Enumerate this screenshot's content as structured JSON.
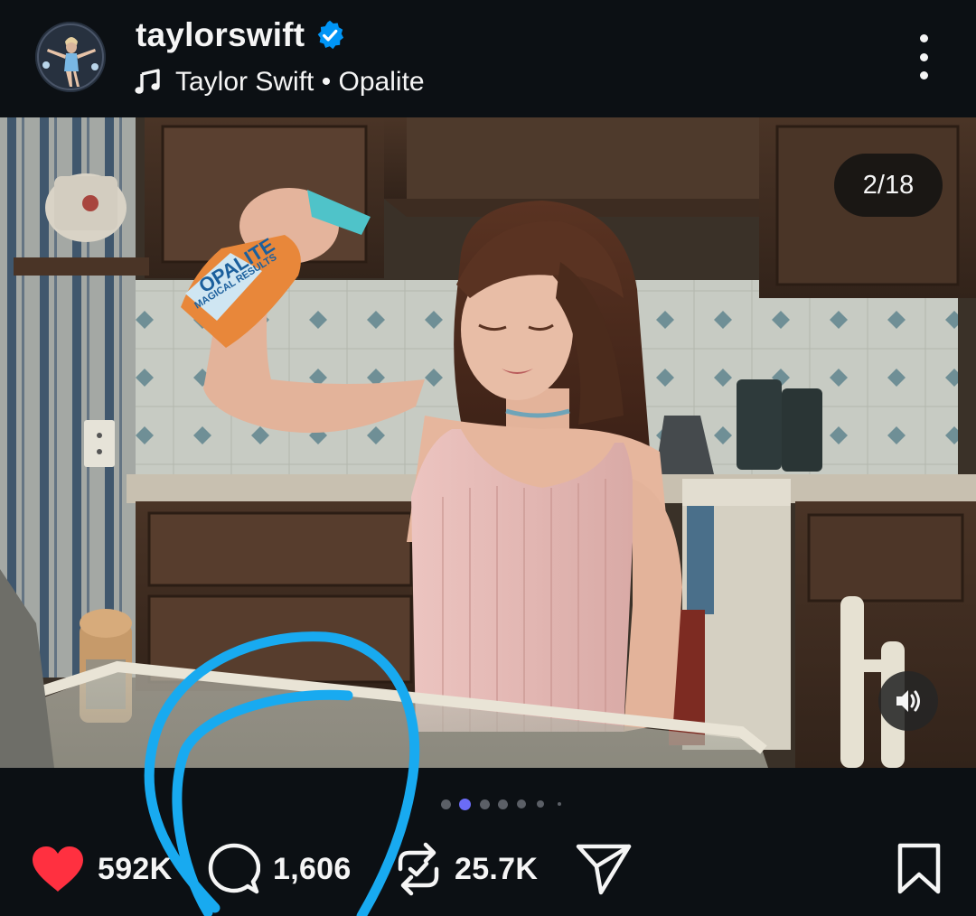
{
  "header": {
    "username": "taylorswift",
    "verified_icon": "verified-badge-icon",
    "audio_icon": "music-note-icon",
    "audio_label": "Taylor Swift • Opalite",
    "more_icon": "more-options-icon"
  },
  "media": {
    "counter": "2/18",
    "sound_icon": "speaker-icon",
    "bottle_brand": "OPALITE",
    "bottle_tagline": "MAGICAL RESULTS",
    "current_slide": 2,
    "total_slides": 18
  },
  "pager": {
    "active_index": 1
  },
  "actions": {
    "like_icon": "heart-icon",
    "like_count": "592K",
    "comment_icon": "comment-icon",
    "comment_count": "1,606",
    "repost_icon": "repost-icon",
    "repost_count": "25.7K",
    "share_icon": "send-icon",
    "save_icon": "bookmark-icon"
  },
  "colors": {
    "background": "#0c1014",
    "like_red": "#ff3040",
    "verified_blue": "#0095f6",
    "annotation_blue": "#18aaf0",
    "active_dot": "#6b6cf6"
  }
}
